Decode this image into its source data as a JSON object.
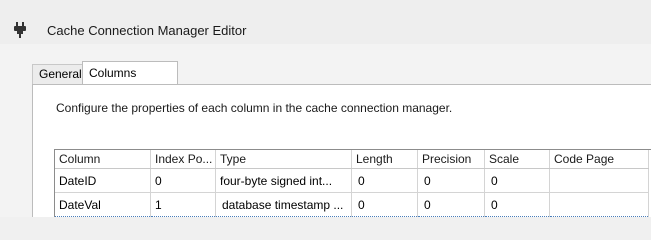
{
  "window": {
    "title": "Cache Connection Manager Editor",
    "icon": "connection-plug-icon"
  },
  "tabs": [
    {
      "label": "General",
      "selected": false
    },
    {
      "label": "Columns",
      "selected": true
    }
  ],
  "columns_page": {
    "description": "Configure the properties of each column in the cache connection manager.",
    "headers": [
      "Column",
      "Index Po...",
      "Type",
      "Length",
      "Precision",
      "Scale",
      "Code Page"
    ],
    "rows": [
      {
        "column": "DateID",
        "index_position": "0",
        "type": "four-byte signed int...",
        "length": "0",
        "precision": "0",
        "scale": "0",
        "code_page": ""
      },
      {
        "column": "DateVal",
        "index_position": "1",
        "type": "database timestamp ...",
        "length": "0",
        "precision": "0",
        "scale": "0",
        "code_page": ""
      }
    ]
  }
}
